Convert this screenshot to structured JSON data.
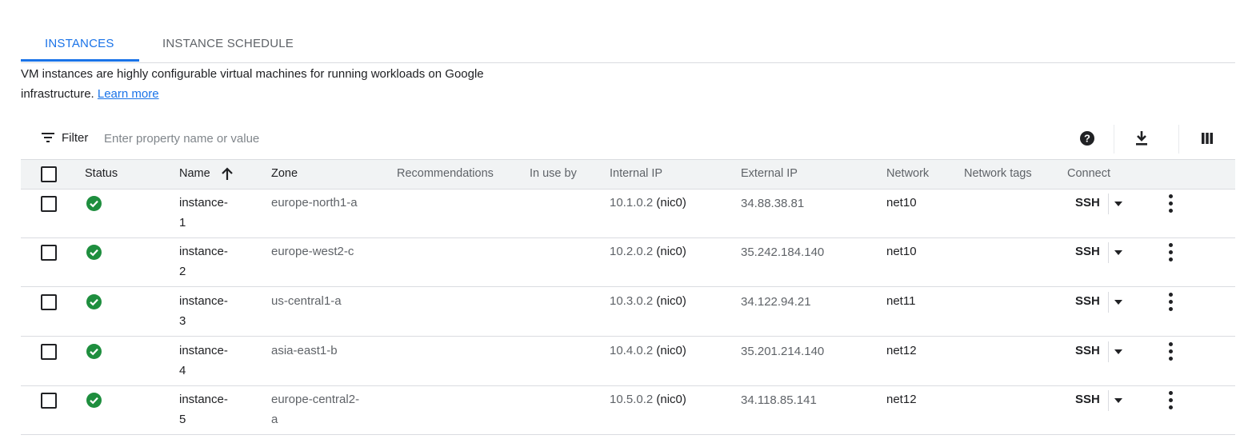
{
  "tabs": [
    {
      "label": "INSTANCES",
      "active": true
    },
    {
      "label": "INSTANCE SCHEDULE",
      "active": false
    }
  ],
  "description": {
    "line1": "VM instances are highly configurable virtual machines for running workloads on Google",
    "line2": "infrastructure.",
    "link": "Learn more"
  },
  "filter": {
    "label": "Filter",
    "placeholder": "Enter property name or value"
  },
  "toolbar_icons": [
    "help-icon",
    "download-icon",
    "columns-icon"
  ],
  "table": {
    "columns": [
      "Status",
      "Name",
      "Zone",
      "Recommendations",
      "In use by",
      "Internal IP",
      "External IP",
      "Network",
      "Network tags",
      "Connect"
    ],
    "sort": {
      "column": "Name",
      "direction": "ascending"
    },
    "rows": [
      {
        "name1": "instance-",
        "name2": "1",
        "zone1": "europe-north1-a",
        "zone2": "",
        "internal_ip": "10.1.0.2",
        "nic": "(nic0)",
        "external_ip": "34.88.38.81",
        "network": "net10",
        "connect": "SSH"
      },
      {
        "name1": "instance-",
        "name2": "2",
        "zone1": "europe-west2-c",
        "zone2": "",
        "internal_ip": "10.2.0.2",
        "nic": "(nic0)",
        "external_ip": "35.242.184.140",
        "network": "net10",
        "connect": "SSH"
      },
      {
        "name1": "instance-",
        "name2": "3",
        "zone1": "us-central1-a",
        "zone2": "",
        "internal_ip": "10.3.0.2",
        "nic": "(nic0)",
        "external_ip": "34.122.94.21",
        "network": "net11",
        "connect": "SSH"
      },
      {
        "name1": "instance-",
        "name2": "4",
        "zone1": "asia-east1-b",
        "zone2": "",
        "internal_ip": "10.4.0.2",
        "nic": "(nic0)",
        "external_ip": "35.201.214.140",
        "network": "net12",
        "connect": "SSH"
      },
      {
        "name1": "instance-",
        "name2": "5",
        "zone1": "europe-central2-",
        "zone2": "a",
        "internal_ip": "10.5.0.2",
        "nic": "(nic0)",
        "external_ip": "34.118.85.141",
        "network": "net12",
        "connect": "SSH"
      }
    ]
  },
  "colors": {
    "accent": "#1a73e8",
    "status_ok": "#1e8e3e",
    "header_bg": "#f1f3f4"
  }
}
